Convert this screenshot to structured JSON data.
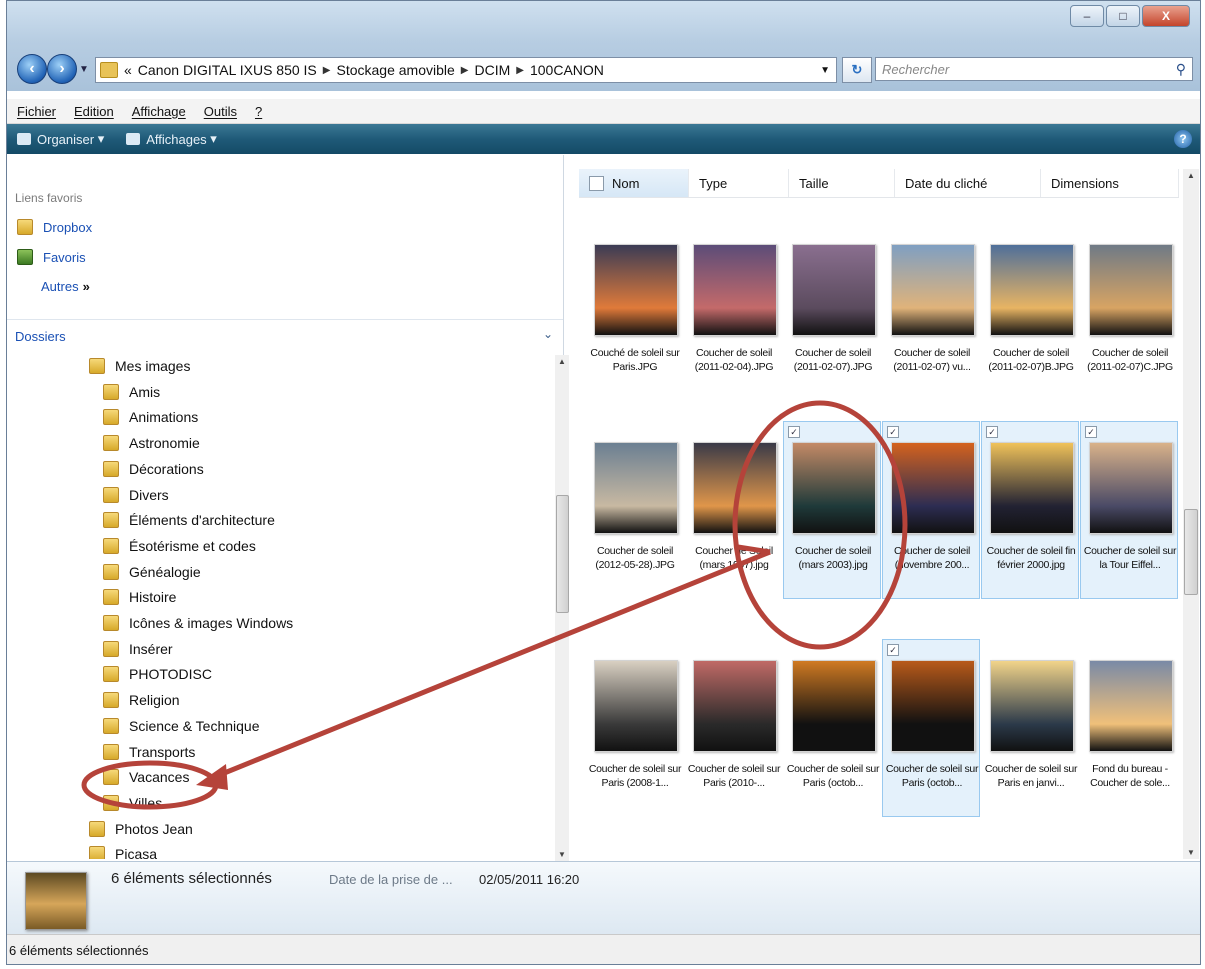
{
  "window": {
    "controls": {
      "minimize": "–",
      "maximize": "□",
      "close": "X"
    }
  },
  "nav": {
    "back_icon": "back-arrow-icon",
    "forward_icon": "forward-arrow-icon",
    "breadcrumb": [
      "«",
      "Canon DIGITAL IXUS 850 IS",
      "Stockage amovible",
      "DCIM",
      "100CANON"
    ],
    "search_placeholder": "Rechercher"
  },
  "menu": [
    "Fichier",
    "Edition",
    "Affichage",
    "Outils",
    "?"
  ],
  "toolbar": {
    "organize": "Organiser",
    "views": "Affichages",
    "help": "?"
  },
  "favorites": {
    "header": "Liens favoris",
    "items": [
      "Dropbox",
      "Favoris"
    ],
    "more": "Autres",
    "more_glyph": "»"
  },
  "folders": {
    "header": "Dossiers",
    "tree": [
      {
        "label": "Mes images",
        "level": 1
      },
      {
        "label": "Amis",
        "level": 2
      },
      {
        "label": "Animations",
        "level": 2
      },
      {
        "label": "Astronomie",
        "level": 2
      },
      {
        "label": "Décorations",
        "level": 2
      },
      {
        "label": "Divers",
        "level": 2
      },
      {
        "label": "Éléments d'architecture",
        "level": 2
      },
      {
        "label": "Ésotérisme et codes",
        "level": 2
      },
      {
        "label": "Généalogie",
        "level": 2
      },
      {
        "label": "Histoire",
        "level": 2
      },
      {
        "label": "Icônes & images Windows",
        "level": 2
      },
      {
        "label": "Insérer",
        "level": 2
      },
      {
        "label": "PHOTODISC",
        "level": 2
      },
      {
        "label": "Religion",
        "level": 2
      },
      {
        "label": "Science & Technique",
        "level": 2
      },
      {
        "label": "Transports",
        "level": 2
      },
      {
        "label": "Vacances",
        "level": 2
      },
      {
        "label": "Villes",
        "level": 2
      },
      {
        "label": "Photos Jean",
        "level": 1
      },
      {
        "label": "Picasa",
        "level": 1
      }
    ]
  },
  "columns": [
    "Nom",
    "Type",
    "Taille",
    "Date du cliché",
    "Dimensions"
  ],
  "files": [
    {
      "name": "Couché de soleil sur Paris.JPG",
      "selected": false,
      "c1": "#3b3b55",
      "c2": "#e07a3a"
    },
    {
      "name": "Coucher de soleil (2011-02-04).JPG",
      "selected": false,
      "c1": "#5c4c78",
      "c2": "#c46a6a"
    },
    {
      "name": "Coucher de soleil (2011-02-07).JPG",
      "selected": false,
      "c1": "#8a6f8f",
      "c2": "#5b4b5e"
    },
    {
      "name": "Coucher de soleil (2011-02-07) vu...",
      "selected": false,
      "c1": "#7f9fc2",
      "c2": "#e0b37a"
    },
    {
      "name": "Coucher de soleil (2011-02-07)B.JPG",
      "selected": false,
      "c1": "#4f6f9a",
      "c2": "#e8b463"
    },
    {
      "name": "Coucher de soleil (2011-02-07)C.JPG",
      "selected": false,
      "c1": "#6f7a86",
      "c2": "#d8a463"
    },
    {
      "name": "Coucher de soleil (2012-05-28).JPG",
      "selected": false,
      "c1": "#6b7f92",
      "c2": "#c8b9a2"
    },
    {
      "name": "Coucher de Soleil (mars 1997).jpg",
      "selected": false,
      "c1": "#3a3a48",
      "c2": "#e0964a"
    },
    {
      "name": "Coucher de soleil (mars 2003).jpg",
      "selected": true,
      "c1": "#c48a66",
      "c2": "#1f3a3a"
    },
    {
      "name": "Coucher de soleil (novembre 200...",
      "selected": true,
      "c1": "#d4621e",
      "c2": "#2d2d52"
    },
    {
      "name": "Coucher de soleil fin février 2000.jpg",
      "selected": true,
      "c1": "#f0c25a",
      "c2": "#222233"
    },
    {
      "name": "Coucher de soleil sur la Tour Eiffel...",
      "selected": true,
      "c1": "#d9b28a",
      "c2": "#4a4a66"
    },
    {
      "name": "Coucher de soleil sur Paris (2008-1...",
      "selected": false,
      "c1": "#d9d0c2",
      "c2": "#3a3a3a"
    },
    {
      "name": "Coucher de soleil sur Paris (2010-...",
      "selected": false,
      "c1": "#c06a66",
      "c2": "#2a2a2a"
    },
    {
      "name": "Coucher de soleil sur Paris (octob...",
      "selected": false,
      "c1": "#d07a22",
      "c2": "#111111"
    },
    {
      "name": "Coucher de soleil sur Paris (octob...",
      "selected": true,
      "c1": "#b85a1a",
      "c2": "#111111"
    },
    {
      "name": "Coucher de soleil sur Paris en janvi...",
      "selected": false,
      "c1": "#f2d48a",
      "c2": "#2c3a4a"
    },
    {
      "name": "Fond du bureau - Coucher de sole...",
      "selected": false,
      "c1": "#7a8aa6",
      "c2": "#f0c07a"
    }
  ],
  "details": {
    "count": "6 éléments sélectionnés",
    "label": "Date de la prise de ...",
    "value": "02/05/2011 16:20"
  },
  "status": "6 éléments sélectionnés",
  "colors": {
    "annotation": "#b5433a",
    "toolbar": "#1f5a78",
    "selection": "#e4f1fb"
  }
}
